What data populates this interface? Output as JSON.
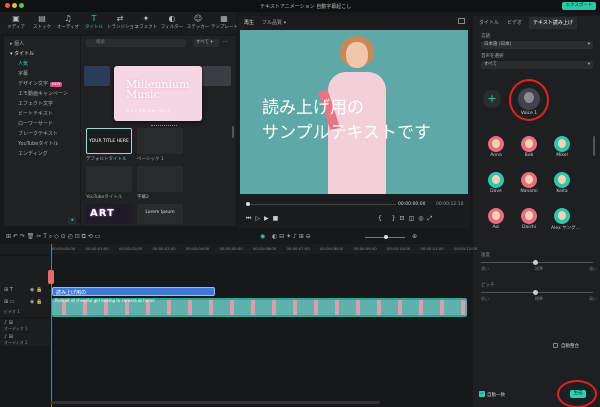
{
  "window": {
    "title": "テキストアニメーション 自動字幕起こし",
    "export_label": "エクスポート"
  },
  "toolbar": [
    {
      "label": "メディア",
      "icon": "media-icon"
    },
    {
      "label": "ストック",
      "icon": "stock-icon"
    },
    {
      "label": "オーディオ",
      "icon": "music-icon"
    },
    {
      "label": "タイトル",
      "icon": "title-icon"
    },
    {
      "label": "トランジション",
      "icon": "transition-icon"
    },
    {
      "label": "エフェクト",
      "icon": "effect-icon"
    },
    {
      "label": "フィルター",
      "icon": "filter-icon"
    },
    {
      "label": "ステッカー",
      "icon": "sticker-icon"
    },
    {
      "label": "テンプレート",
      "icon": "template-icon"
    }
  ],
  "sidebar": {
    "personal": "個人",
    "title_cat": "タイトル",
    "items": [
      "人気",
      "字幕",
      "デザイン文字",
      "エモ動画キャンペーン",
      "エフェクト文字",
      "ビートテキスト",
      "ローワーサード",
      "ブレークテキスト",
      "YouTubeタイトル",
      "エンディング"
    ],
    "new_badge": "NEW"
  },
  "media": {
    "search_placeholder": "検索",
    "filter": "すべて",
    "featured_title": "Millennium Music",
    "featured_sub": "ミレニアム ミュージック",
    "thumbs": [
      {
        "label": "デフォルトタイトル",
        "text": "YOUR TITLE HERE"
      },
      {
        "label": "ベーシック 1",
        "text": ""
      },
      {
        "label": "YouTubeタイトル",
        "text": ""
      },
      {
        "label": "字幕2",
        "text": ""
      },
      {
        "label": "",
        "text": "ART"
      },
      {
        "label": "",
        "text": "Lorem Ipsum"
      }
    ]
  },
  "preview": {
    "tab_play": "再生",
    "quality": "フル品質",
    "caption_line1": "読み上げ用の",
    "caption_line2": "サンプルテキストです",
    "time_current": "00:00:00:00",
    "time_total": "00:00:12:10"
  },
  "right": {
    "tabs": [
      "タイトル",
      "ビデオ",
      "テキスト読み上げ"
    ],
    "lang_label": "言語",
    "lang_value": "日本語 (日本)",
    "voice_label": "音声を選択",
    "voice_filter": "すべて",
    "custom_voice": "Voice 1",
    "voices": [
      {
        "name": "Anna",
        "color": "pink"
      },
      {
        "name": "Bob",
        "color": "pink"
      },
      {
        "name": "Mikel",
        "color": "teal"
      },
      {
        "name": "Dave",
        "color": "teal"
      },
      {
        "name": "Nanami",
        "color": "pink"
      },
      {
        "name": "Keita",
        "color": "teal"
      },
      {
        "name": "Aoi",
        "color": "pink"
      },
      {
        "name": "Daichi",
        "color": "pink"
      },
      {
        "name": "Alex ヤング...",
        "color": "teal"
      }
    ],
    "speed_label": "速度",
    "pitch_label": "ピッチ",
    "speed_ticks": [
      "遅い",
      "",
      "標準",
      "",
      "速い"
    ],
    "pitch_ticks": [
      "低い",
      "",
      "標準",
      "",
      "高い"
    ],
    "auto_match": "自動整合",
    "sync_label": "自動一致",
    "generate_button": "生成"
  },
  "timeline": {
    "ruler": [
      "00:00:00:00",
      "00:00:01:00",
      "00:00:02:00",
      "00:00:03:00",
      "00:00:04:00",
      "00:00:05:00",
      "00:00:06:00",
      "00:00:07:00",
      "00:00:08:00",
      "00:00:09:00",
      "00:00:10:00",
      "00:00:11:00",
      "00:00:12:00"
    ],
    "title_clip": "読み上げ用の",
    "video_clip": "Portrait of cheerful girl talking to camera at home",
    "track_labels": [
      "ビデオ 1",
      "オーディオ 1",
      "オーディオ 2"
    ]
  },
  "colors": {
    "accent": "#29d3b1",
    "highlight_circle": "#e0231d",
    "title_clip": "#3f7bd6",
    "video_clip": "#2aa99a"
  }
}
